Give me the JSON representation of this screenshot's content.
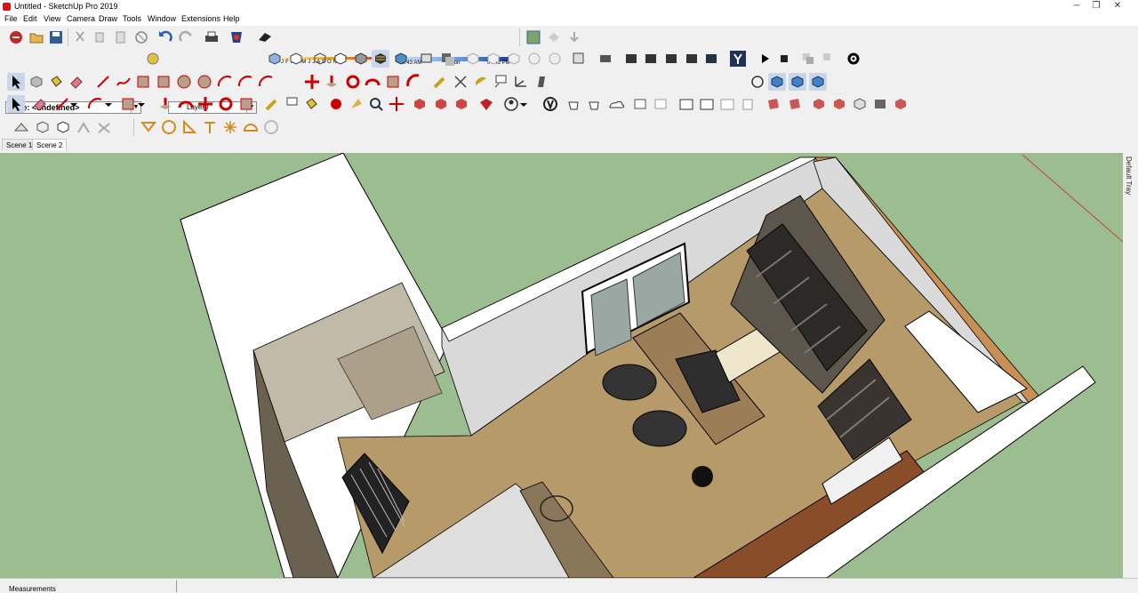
{
  "window": {
    "title": "Untitled - SketchUp Pro 2019",
    "minimize": "─",
    "maximize": "❐",
    "close": "✕"
  },
  "menu": [
    "File",
    "Edit",
    "View",
    "Camera",
    "Draw",
    "Tools",
    "Window",
    "Extensions",
    "Help"
  ],
  "entity_info": {
    "type_value": "Type: <undefined>",
    "layer_value": "Layer0"
  },
  "shadows": {
    "months": "J F M A M J J A S O N D",
    "time_start": "06:43 AM",
    "time_mid": "Noon",
    "time_end": "04:45 PM"
  },
  "toolbar_icons": {
    "row1": [
      "extension-warehouse-icon",
      "open-icon",
      "save-icon",
      "cut-icon",
      "copy-icon",
      "paste-icon",
      "erase-icon",
      "undo-icon",
      "redo-icon",
      "print-icon",
      "model-info-icon",
      "shadow-toggle-icon",
      "add-location-icon",
      "photo-texture-icon",
      "preview-icon",
      "send-to-layout-icon",
      "component-icon",
      "xray-icon",
      "back-edges-icon",
      "wireframe-icon",
      "hidden-line-icon",
      "shaded-icon",
      "textured-icon",
      "monochrome-icon",
      "sketchy-edges-icon",
      "visible-icon",
      "hidden-icon",
      "iso-icon",
      "top-view-icon",
      "front-view-icon",
      "right-view-icon",
      "back-view-icon",
      "left-view-icon",
      "bottom-view-icon",
      "perspective-icon",
      "dynamic-component-icon",
      "extension-icon-1",
      "extension-icon-2",
      "extension-icon-3",
      "extension-icon-4",
      "extension-icon-5",
      "sketchup-ruby-icon",
      "play-icon",
      "stop-icon",
      "solid-tools-icon",
      "trim-icon",
      "settings-gear-icon"
    ],
    "row2": [
      "select-icon",
      "make-component-icon",
      "paint-bucket-icon",
      "eraser-icon",
      "line-icon",
      "freehand-icon",
      "rectangle-icon",
      "rotated-rectangle-icon",
      "circle-icon",
      "polygon-icon",
      "arc-icon",
      "pie-icon",
      "arc-3pt-icon",
      "move-icon",
      "push-pull-icon",
      "rotate-icon",
      "follow-me-icon",
      "scale-icon",
      "offset-icon",
      "tape-measure-icon",
      "dimension-icon",
      "protractor-icon",
      "text-icon",
      "axes-icon",
      "3d-text-icon",
      "orbit-icon",
      "pan-icon",
      "zoom-icon",
      "zoom-window-icon"
    ],
    "row3": [
      "select-arrow-icon",
      "eraser-small-icon",
      "pencil-icon",
      "dropdown-arrow-icon",
      "circle-tool-icon",
      "dropdown-arrow-icon",
      "rectangle-tool-icon",
      "dropdown-arrow-icon",
      "push-pull-2-icon",
      "follow-me-2-icon",
      "move-2-icon",
      "rotate-2-icon",
      "scale-2-icon",
      "tape-2-icon",
      "text-2-icon",
      "paint-2-icon",
      "walk-icon",
      "look-around-icon",
      "position-camera-icon",
      "section-plane-icon",
      "display-section-icon",
      "section-cut-icon",
      "orbit-2-icon",
      "zoom-2-icon",
      "zoom-extents-icon",
      "previous-view-icon",
      "warehouse-3d-icon",
      "components-icon",
      "styles-icon",
      "scenes-icon",
      "shadows-icon",
      "fog-icon",
      "match-photo-icon",
      "layers-icon",
      "outliner-icon",
      "entity-info-icon",
      "instructor-icon",
      "materials-icon",
      "soften-edges-icon",
      "sandbox-1-icon",
      "sandbox-2-icon",
      "sandbox-3-icon",
      "sandbox-4-icon",
      "sandbox-5-icon",
      "sandbox-6-icon"
    ],
    "row4": [
      "sandbox-from-contours-icon",
      "sandbox-from-scratch-icon",
      "smoove-icon",
      "stamp-icon",
      "drape-icon",
      "add-detail-icon",
      "flip-edge-icon",
      "solid-union-icon",
      "solid-subtract-icon",
      "solid-trim-icon",
      "solid-split-icon",
      "solid-intersect-icon",
      "solid-outer-shell-icon"
    ]
  },
  "scenes": [
    "Scene 1",
    "Scene 2"
  ],
  "active_scene": "Scene 2",
  "tray": "Default Tray",
  "status": {
    "measurements_label": "Measurements"
  },
  "colors": {
    "viewport_ground": "#9bbd90",
    "floor": "#b69a6a",
    "walls": "#d8d8d8"
  }
}
